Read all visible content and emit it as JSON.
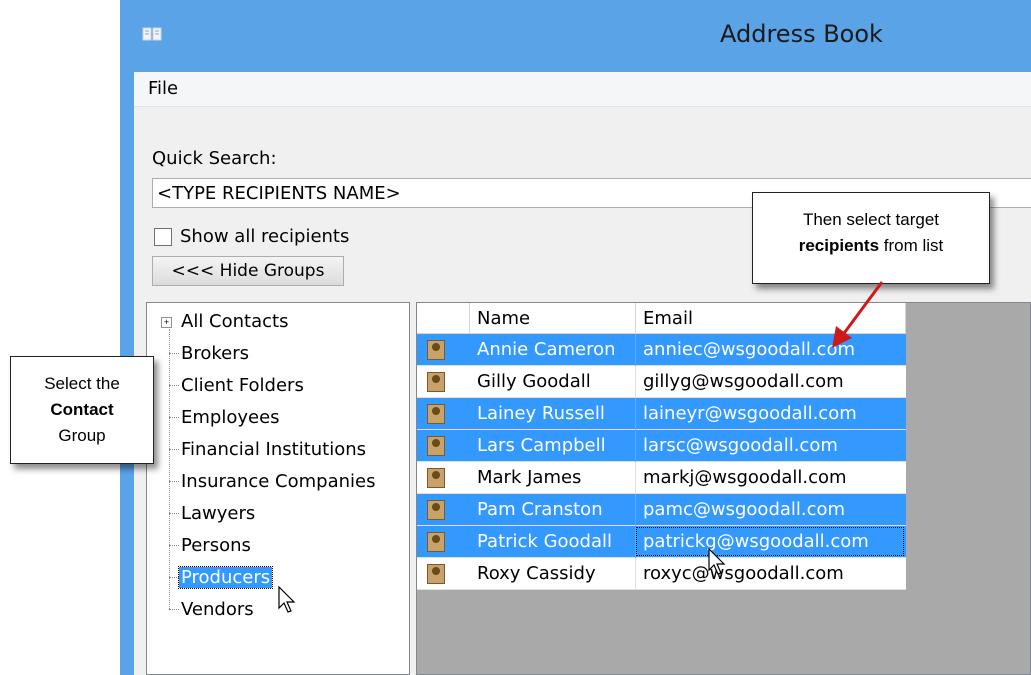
{
  "window": {
    "title": "Address Book"
  },
  "menu": {
    "file": "File"
  },
  "search": {
    "label": "Quick Search:",
    "value": "<TYPE RECIPIENTS NAME>"
  },
  "show_all": {
    "label": "Show all recipients",
    "checked": false
  },
  "hide_groups_button": "<<< Hide Groups",
  "tree": {
    "items": [
      {
        "label": "All Contacts",
        "expander": "+"
      },
      {
        "label": "Brokers"
      },
      {
        "label": "Client Folders"
      },
      {
        "label": "Employees"
      },
      {
        "label": "Financial Institutions"
      },
      {
        "label": "Insurance Companies"
      },
      {
        "label": "Lawyers"
      },
      {
        "label": "Persons"
      },
      {
        "label": "Producers",
        "selected": true
      },
      {
        "label": "Vendors"
      }
    ]
  },
  "grid": {
    "headers": {
      "name": "Name",
      "email": "Email"
    },
    "rows": [
      {
        "name": "Annie Cameron",
        "email": "anniec@wsgoodall.com",
        "selected": true
      },
      {
        "name": "Gilly Goodall",
        "email": "gillyg@wsgoodall.com",
        "selected": false
      },
      {
        "name": "Lainey Russell",
        "email": "laineyr@wsgoodall.com",
        "selected": true
      },
      {
        "name": "Lars Campbell",
        "email": "larsc@wsgoodall.com",
        "selected": true
      },
      {
        "name": "Mark James",
        "email": "markj@wsgoodall.com",
        "selected": false
      },
      {
        "name": "Pam Cranston",
        "email": "pamc@wsgoodall.com",
        "selected": true
      },
      {
        "name": "Patrick Goodall",
        "email": "patrickg@wsgoodall.com",
        "selected": true
      },
      {
        "name": "Roxy Cassidy",
        "email": "roxyc@wsgoodall.com",
        "selected": false
      }
    ]
  },
  "callouts": {
    "left": {
      "line1": "Select the",
      "bold": "Contact",
      "line2": "Group"
    },
    "right": {
      "line1": "Then select target",
      "bold": "recipients",
      "line2": "from list"
    }
  },
  "colors": {
    "title_bar": "#5aa3e6",
    "selection": "#3399ff",
    "arrow": "#cc1a1a"
  }
}
